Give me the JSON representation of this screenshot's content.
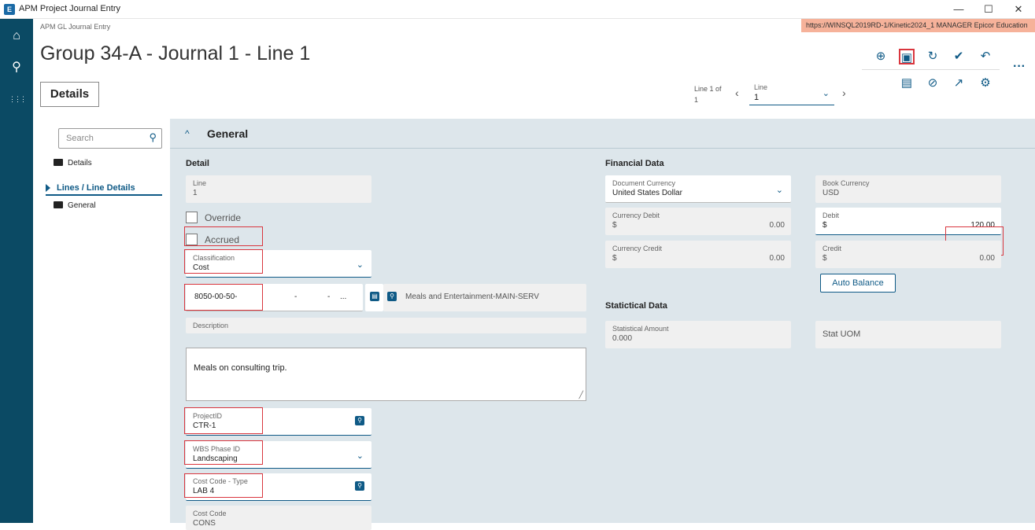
{
  "window": {
    "logo": "E",
    "title": "APM Project Journal Entry",
    "minimize": "—",
    "maximize": "☐",
    "close": "✕"
  },
  "nav": {
    "home": "⌂",
    "search": "⚲",
    "apps": "⋮⋮⋮"
  },
  "header": {
    "breadcrumb": "APM GL Journal Entry",
    "session": "https://WINSQL2019RD-1/Kinetic2024_1   MANAGER   Epicor Education",
    "page_title": "Group 34-A - Journal 1 - Line 1",
    "tab_label": "Details"
  },
  "toolbar": {
    "new": "⊕",
    "save": "▣",
    "refresh": "↻",
    "clear": "✔",
    "undo": "↶",
    "more": "···",
    "panel": "▤",
    "attach": "⊘",
    "open": "↗",
    "settings": "⚙"
  },
  "line_nav": {
    "line_of_label": "Line 1 of",
    "line_of_count": "1",
    "prev": "‹",
    "next": "›",
    "select_label": "Line",
    "select_value": "1",
    "chevron": "⌄"
  },
  "sidebar": {
    "search_placeholder": "Search",
    "search_icon": "⚲",
    "items": [
      {
        "label": "Details"
      },
      {
        "label": "Lines / Line Details"
      },
      {
        "label": "General"
      }
    ]
  },
  "section": {
    "chevron": "^",
    "title": "General"
  },
  "detail": {
    "group_label": "Detail",
    "line_label": "Line",
    "line_value": "1",
    "override_label": "Override",
    "accrued_label": "Accrued",
    "classification_label": "Classification",
    "classification_value": "Cost",
    "account_seg1": "8050-00-50-",
    "account_seg2": "-",
    "account_seg3": "-",
    "account_ellipsis": "...",
    "account_description": "Meals and Entertainment-MAIN-SERV",
    "description_label": "Description",
    "description_value": "Meals on consulting trip.",
    "projectid_label": "ProjectID",
    "projectid_value": "CTR-1",
    "wbs_label": "WBS Phase ID",
    "wbs_value": "Landscaping",
    "costcode_type_label": "Cost Code - Type",
    "costcode_type_value": "LAB 4",
    "costcode_label": "Cost Code",
    "costcode_value": "CONS"
  },
  "financial": {
    "group_label": "Financial Data",
    "doc_currency_label": "Document Currency",
    "doc_currency_value": "United States Dollar",
    "book_currency_label": "Book Currency",
    "book_currency_value": "USD",
    "currency_debit_label": "Currency Debit",
    "currency_debit_symbol": "$",
    "currency_debit_value": "0.00",
    "debit_label": "Debit",
    "debit_symbol": "$",
    "debit_value": "120.00",
    "currency_credit_label": "Currency Credit",
    "currency_credit_symbol": "$",
    "currency_credit_value": "0.00",
    "credit_label": "Credit",
    "credit_symbol": "$",
    "credit_value": "0.00",
    "auto_balance_label": "Auto Balance"
  },
  "statistical": {
    "group_label": "Statictical Data",
    "amount_label": "Statistical Amount",
    "amount_value": "0.000",
    "uom_label": "Stat UOM"
  },
  "colors": {
    "nav_rail": "#0b4a64",
    "accent": "#0f5a86",
    "highlight": "#d9363e",
    "session_bar": "#f6b29a",
    "content_bg": "#dde6eb"
  }
}
